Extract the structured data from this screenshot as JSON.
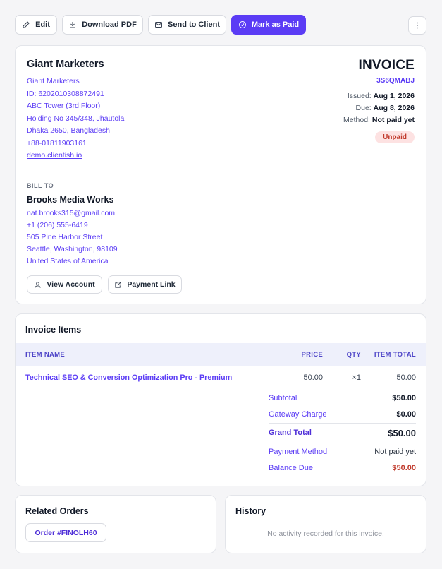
{
  "toolbar": {
    "edit_label": "Edit",
    "download_label": "Download PDF",
    "send_label": "Send to Client",
    "mark_paid_label": "Mark as Paid",
    "more_icon": "⋮"
  },
  "company": {
    "name": "Giant Marketers",
    "lines": [
      "Giant Marketers",
      "ID: 6202010308872491",
      "ABC Tower (3rd Floor)",
      "Holding No 345/348, Jhautola",
      "Dhaka 2650, Bangladesh",
      "+88-01811903161"
    ],
    "website": "demo.clientish.io"
  },
  "invoice": {
    "heading": "INVOICE",
    "number": "3S6QMABJ",
    "issued_label": "Issued:",
    "issued": "Aug 1, 2026",
    "due_label": "Due:",
    "due": "Aug 8, 2026",
    "method_label": "Method:",
    "method": "Not paid yet",
    "status": "Unpaid"
  },
  "bill_to": {
    "heading": "BILL TO",
    "name": "Brooks Media Works",
    "lines": [
      "nat.brooks315@gmail.com",
      "+1 (206) 555-6419",
      "505 Pine Harbor Street",
      "Seattle, Washington, 98109",
      "United States of America"
    ],
    "view_account_label": "View Account",
    "payment_link_label": "Payment Link"
  },
  "items": {
    "title": "Invoice Items",
    "columns": [
      "ITEM NAME",
      "PRICE",
      "QTY",
      "ITEM TOTAL"
    ],
    "rows": [
      {
        "name": "Technical SEO & Conversion Optimization Pro - Premium",
        "price": "50.00",
        "qty": "×1",
        "total": "50.00"
      }
    ],
    "totals": {
      "subtotal_label": "Subtotal",
      "subtotal": "$50.00",
      "gateway_label": "Gateway Charge",
      "gateway": "$0.00",
      "grand_label": "Grand Total",
      "grand": "$50.00",
      "payment_method_label": "Payment Method",
      "payment_method": "Not paid yet",
      "balance_label": "Balance Due",
      "balance": "$50.00"
    }
  },
  "related": {
    "title": "Related Orders",
    "order_label": "Order #FINOLH60"
  },
  "history": {
    "title": "History",
    "empty": "No activity recorded for this invoice."
  },
  "colors": {
    "accent": "#5b3cf5",
    "danger": "#c0392b",
    "badge_bg": "#fde2e2"
  }
}
